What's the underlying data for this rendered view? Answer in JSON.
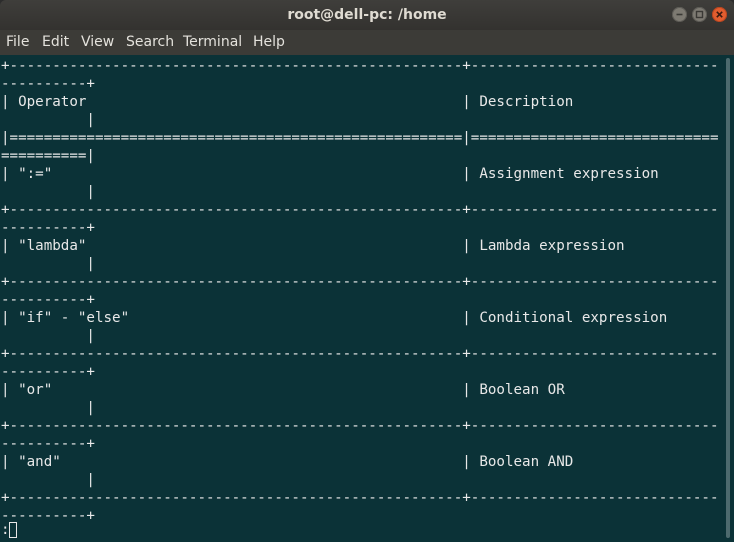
{
  "window": {
    "title": "root@dell-pc: /home"
  },
  "menubar": {
    "items": [
      "File",
      "Edit",
      "View",
      "Search",
      "Terminal",
      "Help"
    ]
  },
  "terminal": {
    "lines": [
      "+-----------------------------------------------------+-----------------------------",
      "----------+",
      "| Operator                                            | Description",
      "          |",
      "|=====================================================|=============================",
      "==========|",
      "| \":=\"                                                | Assignment expression",
      "          |",
      "+-----------------------------------------------------+-----------------------------",
      "----------+",
      "| \"lambda\"                                            | Lambda expression",
      "          |",
      "+-----------------------------------------------------+-----------------------------",
      "----------+",
      "| \"if\" - \"else\"                                       | Conditional expression",
      "          |",
      "+-----------------------------------------------------+-----------------------------",
      "----------+",
      "| \"or\"                                                | Boolean OR",
      "          |",
      "+-----------------------------------------------------+-----------------------------",
      "----------+",
      "| \"and\"                                               | Boolean AND",
      "          |",
      "+-----------------------------------------------------+-----------------------------",
      "----------+",
      ":"
    ]
  },
  "colors": {
    "terminal_bg": "#0b3237",
    "terminal_fg": "#e8e8e8",
    "titlebar_bg": "#3c3b37",
    "close_button": "#e25d2f"
  }
}
